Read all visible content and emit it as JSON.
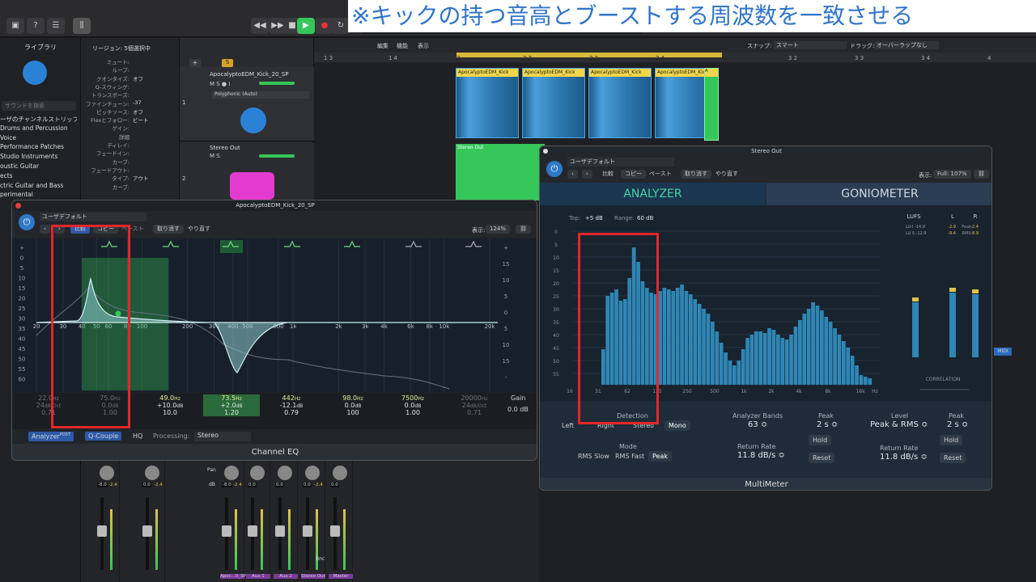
{
  "caption": "※キックの持つ音高とブーストする周波数を一致させる",
  "colors": {
    "accent": "#35c759",
    "eq_curve": "#8ecbcf",
    "spectrum": "#2f86b5",
    "redbox": "#e4262a",
    "region_header": "#f0d64a"
  },
  "library": {
    "title": "ライブラリ",
    "search_placeholder": "サウンドを検索",
    "items": [
      "ーザのチャンネルストリップ…",
      "Drums and Percussion",
      "Voice",
      "Performance Patches",
      "Studio Instruments",
      "oustic Guitar",
      "ects",
      "ctric Guitar and Bass",
      "perimental"
    ]
  },
  "inspector": {
    "title": "リージョン: 5個選択中",
    "rows": [
      {
        "k": "ミュート:",
        "v": ""
      },
      {
        "k": "ループ:",
        "v": ""
      },
      {
        "k": "クオンタイズ:",
        "v": "オフ"
      },
      {
        "k": "Q-スウィング:",
        "v": ""
      },
      {
        "k": "トランスポーズ:",
        "v": ""
      },
      {
        "k": "ファインチューン:",
        "v": "-37"
      },
      {
        "k": "ピッチソース:",
        "v": "オフ"
      },
      {
        "k": "Flexとフォロー:",
        "v": "ビート"
      },
      {
        "k": "ゲイン:",
        "v": ""
      },
      {
        "k": "詳細",
        "v": ""
      },
      {
        "k": "ディレイ:",
        "v": ""
      },
      {
        "k": "フェードイン:",
        "v": ""
      },
      {
        "k": "カーブ:",
        "v": ""
      },
      {
        "k": "フェードアウト:",
        "v": ""
      },
      {
        "k": "タイプ:",
        "v": "アウト"
      },
      {
        "k": "カーブ:",
        "v": ""
      }
    ]
  },
  "arrange": {
    "menu": [
      "編集",
      "機能",
      "表示"
    ],
    "snap_label": "スナップ:",
    "snap_value": "スマート",
    "drag_label": "ドラッグ:",
    "drag_value": "オーバーラップなし",
    "ruler": [
      "1 3",
      "1 4",
      "2",
      "2 2",
      "2 3",
      "2 4",
      "3",
      "3 2",
      "3 3",
      "3 4",
      "4"
    ],
    "region_name": "ApocalyptoEDM_Kick",
    "stereo_region": "Stereo Out"
  },
  "tracks": [
    {
      "name": "ApocalyptoEDM_Kick_20_SP",
      "num": "1",
      "sub": "Polyphonic (Auto)"
    },
    {
      "name": "Stereo Out",
      "num": "2"
    }
  ],
  "eq": {
    "title": "ApocalyptoEDM_Kick_20_SP",
    "preset": "ユーザデフォルト",
    "buttons": [
      "比較",
      "コピー",
      "ペースト",
      "取り消す",
      "やり直す"
    ],
    "view_label": "表示:",
    "view_value": "124%",
    "footer": "Channel EQ",
    "bottom": {
      "analyzer": "Analyzer",
      "post": "POST",
      "qcouple": "Q-Couple",
      "hq": "HQ",
      "processing_label": "Processing:",
      "processing_value": "Stereo"
    },
    "freq_labels": [
      "20",
      "30",
      "40",
      "50",
      "60",
      "80",
      "100",
      "200",
      "300",
      "400",
      "500",
      "800",
      "1k",
      "2k",
      "3k",
      "4k",
      "6k",
      "8k",
      "10k",
      "20k"
    ],
    "db_left": [
      "+",
      "0",
      "5",
      "10",
      "15",
      "20",
      "25",
      "30",
      "35",
      "40",
      "45",
      "50",
      "55",
      "60"
    ],
    "db_right": [
      "+",
      "15",
      "10",
      "5",
      "0",
      "5",
      "10",
      "15",
      "-"
    ],
    "gain_label": "Gain",
    "bands": [
      {
        "freq": "22.0",
        "fu": "Hz",
        "gain": "24",
        "gu": "dB/Oct",
        "q": "0.71"
      },
      {
        "freq": "75.0",
        "fu": "Hz",
        "gain": "0.0",
        "gu": "dB",
        "q": "1.00"
      },
      {
        "freq": "49.0",
        "fu": "Hz",
        "gain": "+10.0",
        "gu": "dB",
        "q": "10.0"
      },
      {
        "freq": "73.5",
        "fu": "Hz",
        "gain": "+2.0",
        "gu": "dB",
        "q": "1.20"
      },
      {
        "freq": "442",
        "fu": "Hz",
        "gain": "-12.1",
        "gu": "dB",
        "q": "0.79"
      },
      {
        "freq": "98.0",
        "fu": "Hz",
        "gain": "0.0",
        "gu": "dB",
        "q": "100"
      },
      {
        "freq": "7500",
        "fu": "Hz",
        "gain": "0.0",
        "gu": "dB",
        "q": "1.00"
      },
      {
        "freq": "20000",
        "fu": "Hz",
        "gain": "24",
        "gu": "dB/Oct",
        "q": "0.71"
      }
    ],
    "master_gain": "0.0 dB"
  },
  "mm": {
    "title": "Stereo Out",
    "preset": "ユーザデフォルト",
    "buttons": [
      "比較",
      "コピー",
      "ペースト",
      "取り消す",
      "やり直す"
    ],
    "view_label": "表示:",
    "view_value": "Full: 107%",
    "tabs": [
      "ANALYZER",
      "GONIOMETER"
    ],
    "top_label": "Top:",
    "top_value": "+5 dB",
    "range_label": "Range:",
    "range_value": "60 dB",
    "db_axis": [
      "0",
      "5",
      "10",
      "15",
      "20",
      "25",
      "30",
      "35",
      "40",
      "45",
      "50",
      "55"
    ],
    "freq_axis": [
      "16",
      "31",
      "62",
      "125",
      "250",
      "500",
      "1k",
      "2k",
      "4k",
      "8k",
      "16k",
      "Hz"
    ],
    "lufs": "LUFS",
    "lufs_rows": [
      "LU-I -14.8",
      "LU S -12.9"
    ],
    "lr": [
      "L",
      "R"
    ],
    "peak_label": "Peak",
    "rms_label": "RMS",
    "peak_l": "-2.9",
    "peak_r": "-2.4",
    "rms_l": "-9.4",
    "rms_r": "-8.9",
    "correlation": "CORRELATION",
    "detection": {
      "label": "Detection",
      "options": [
        "Left",
        "Right",
        "Stereo",
        "Mono"
      ],
      "active": "Mono"
    },
    "mode": {
      "label": "Mode",
      "options": [
        "RMS Slow",
        "RMS Fast",
        "Peak"
      ],
      "active": "Peak"
    },
    "bands": {
      "label": "Analyzer Bands",
      "value": "63 ≎"
    },
    "rate": {
      "label": "Return Rate",
      "value": "11.8 dB/s ≎"
    },
    "peak1": {
      "label": "Peak",
      "value": "2 s ≎",
      "hold": "Hold",
      "reset": "Reset"
    },
    "level": {
      "label": "Level",
      "value": "Peak & RMS ≎",
      "rate_label": "Return Rate",
      "rate_value": "11.8 dB/s ≎"
    },
    "peak2": {
      "label": "Peak",
      "value": "2 s ≎",
      "hold": "Hold",
      "reset": "Reset"
    },
    "footer": "MultiMeter",
    "spectrum": [
      22,
      55,
      57,
      59,
      52,
      53,
      66,
      85,
      76,
      64,
      60,
      57,
      56,
      58,
      60,
      59,
      58,
      60,
      62,
      58,
      56,
      53,
      50,
      47,
      44,
      39,
      33,
      26,
      20,
      15,
      12,
      15,
      22,
      29,
      31,
      33,
      33,
      32,
      35,
      34,
      31,
      29,
      28,
      31,
      36,
      40,
      44,
      47,
      51,
      49,
      46,
      42,
      39,
      35,
      31,
      27,
      23,
      18,
      12,
      6,
      5,
      4
    ]
  },
  "mixer": {
    "strips": [
      {
        "name": "",
        "vals": [
          "-8.0",
          "-2.4"
        ]
      },
      {
        "name": "",
        "vals": [
          "0.0",
          "-2.4"
        ]
      },
      {
        "name": "Apoc...0_SP",
        "vals": [
          "-8.0",
          "-2.4"
        ]
      },
      {
        "name": "Aux 1",
        "vals": [
          "0.0",
          ""
        ]
      },
      {
        "name": "Aux 2",
        "vals": [
          "0.0",
          ""
        ]
      },
      {
        "name": "Stereo Out",
        "vals": [
          "0.0",
          "-2.4"
        ]
      },
      {
        "name": "Master",
        "vals": [
          "0.0",
          ""
        ]
      }
    ],
    "pan": "Pan",
    "db": "dB",
    "bnc": "Bnc",
    "midi": "MIDI"
  }
}
